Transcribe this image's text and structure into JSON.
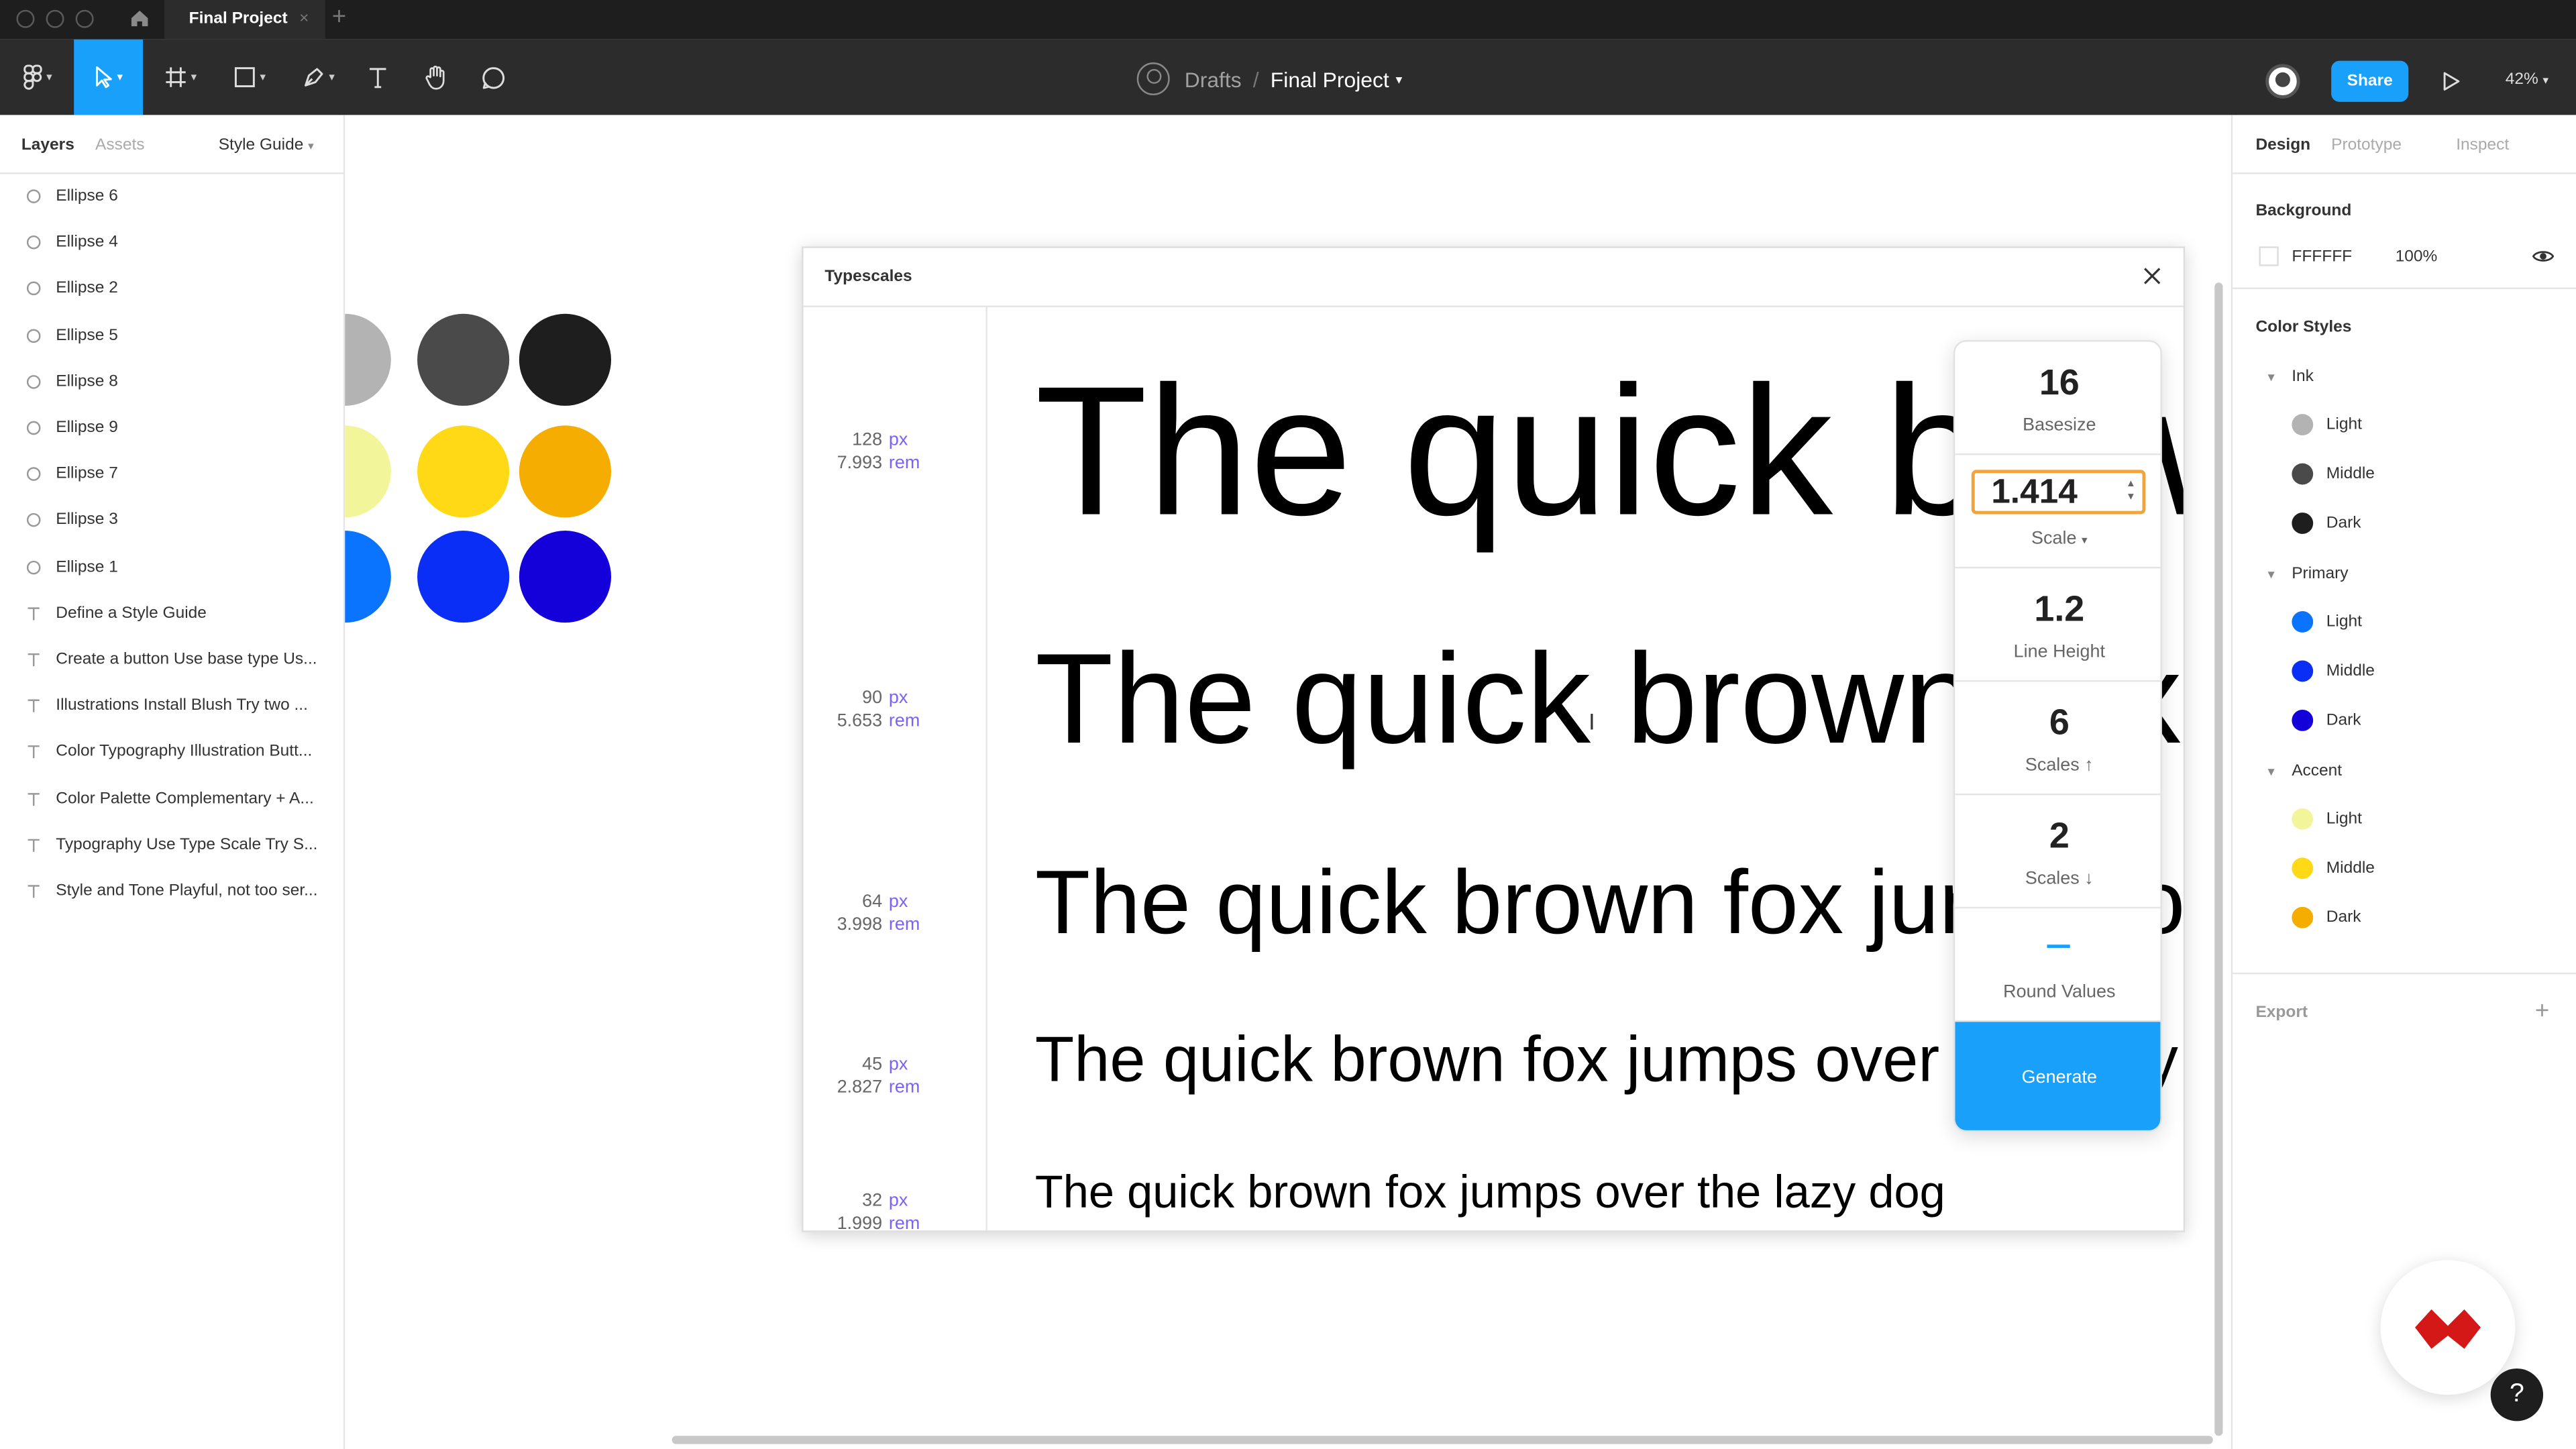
{
  "titlebar": {
    "tab_title": "Final Project",
    "tab_close": "×",
    "tab_add": "+"
  },
  "header": {
    "breadcrumb_parent": "Drafts",
    "breadcrumb_sep": "/",
    "file_title": "Final Project",
    "share_label": "Share",
    "zoom": "42%"
  },
  "left_panel": {
    "tabs": [
      "Layers",
      "Assets"
    ],
    "page_selector": "Style Guide",
    "layers": [
      {
        "type": "ellipse",
        "name": "Ellipse 6"
      },
      {
        "type": "ellipse",
        "name": "Ellipse 4"
      },
      {
        "type": "ellipse",
        "name": "Ellipse 2"
      },
      {
        "type": "ellipse",
        "name": "Ellipse 5"
      },
      {
        "type": "ellipse",
        "name": "Ellipse 8"
      },
      {
        "type": "ellipse",
        "name": "Ellipse 9"
      },
      {
        "type": "ellipse",
        "name": "Ellipse 7"
      },
      {
        "type": "ellipse",
        "name": "Ellipse 3"
      },
      {
        "type": "ellipse",
        "name": "Ellipse 1"
      },
      {
        "type": "text",
        "name": "Define a Style Guide"
      },
      {
        "type": "text",
        "name": "Create a button Use base type Us..."
      },
      {
        "type": "text",
        "name": "Illustrations Install Blush Try two ..."
      },
      {
        "type": "text",
        "name": "Color Typography Illustration Butt..."
      },
      {
        "type": "text",
        "name": "Color Palette Complementary + A..."
      },
      {
        "type": "text",
        "name": "Typography Use Type Scale Try S..."
      },
      {
        "type": "text",
        "name": "Style and Tone Playful, not too ser..."
      }
    ]
  },
  "canvas": {
    "swatches": [
      "#b3b3b3",
      "#4a4a4a",
      "#1e1e1e",
      "#f3f59a",
      "#ffd915",
      "#f4ad00",
      "#0a74ff",
      "#0a2ef5",
      "#1400d8"
    ]
  },
  "plugin": {
    "title": "Typescales",
    "sample_text": "The quick brown fox jumps over the lazy dog",
    "px_unit": "px",
    "rem_unit": "rem",
    "scales": [
      {
        "px": "128",
        "rem": "7.993"
      },
      {
        "px": "90",
        "rem": "5.653"
      },
      {
        "px": "64",
        "rem": "3.998"
      },
      {
        "px": "45",
        "rem": "2.827"
      },
      {
        "px": "32",
        "rem": "1.999"
      }
    ],
    "settings": {
      "basesize_value": "16",
      "basesize_label": "Basesize",
      "scale_value": "1.414",
      "scale_label": "Scale",
      "line_height_value": "1.2",
      "line_height_label": "Line Height",
      "scales_up_value": "6",
      "scales_up_label": "Scales ↑",
      "scales_down_value": "2",
      "scales_down_label": "Scales ↓",
      "round_label": "Round Values",
      "generate_label": "Generate"
    }
  },
  "right_panel": {
    "tabs": [
      "Design",
      "Prototype",
      "Inspect"
    ],
    "background_title": "Background",
    "background_hex": "FFFFFF",
    "background_opacity": "100%",
    "color_styles_title": "Color Styles",
    "groups": [
      {
        "name": "Ink",
        "styles": [
          {
            "name": "Light",
            "color": "#b3b3b3"
          },
          {
            "name": "Middle",
            "color": "#4a4a4a"
          },
          {
            "name": "Dark",
            "color": "#1e1e1e"
          }
        ]
      },
      {
        "name": "Primary",
        "styles": [
          {
            "name": "Light",
            "color": "#0a74ff"
          },
          {
            "name": "Middle",
            "color": "#0a2ef5"
          },
          {
            "name": "Dark",
            "color": "#1400d8"
          }
        ]
      },
      {
        "name": "Accent",
        "styles": [
          {
            "name": "Light",
            "color": "#f3f59a"
          },
          {
            "name": "Middle",
            "color": "#ffd915"
          },
          {
            "name": "Dark",
            "color": "#f4ad00"
          }
        ]
      }
    ],
    "export_title": "Export",
    "export_add": "+"
  },
  "help_label": "?"
}
